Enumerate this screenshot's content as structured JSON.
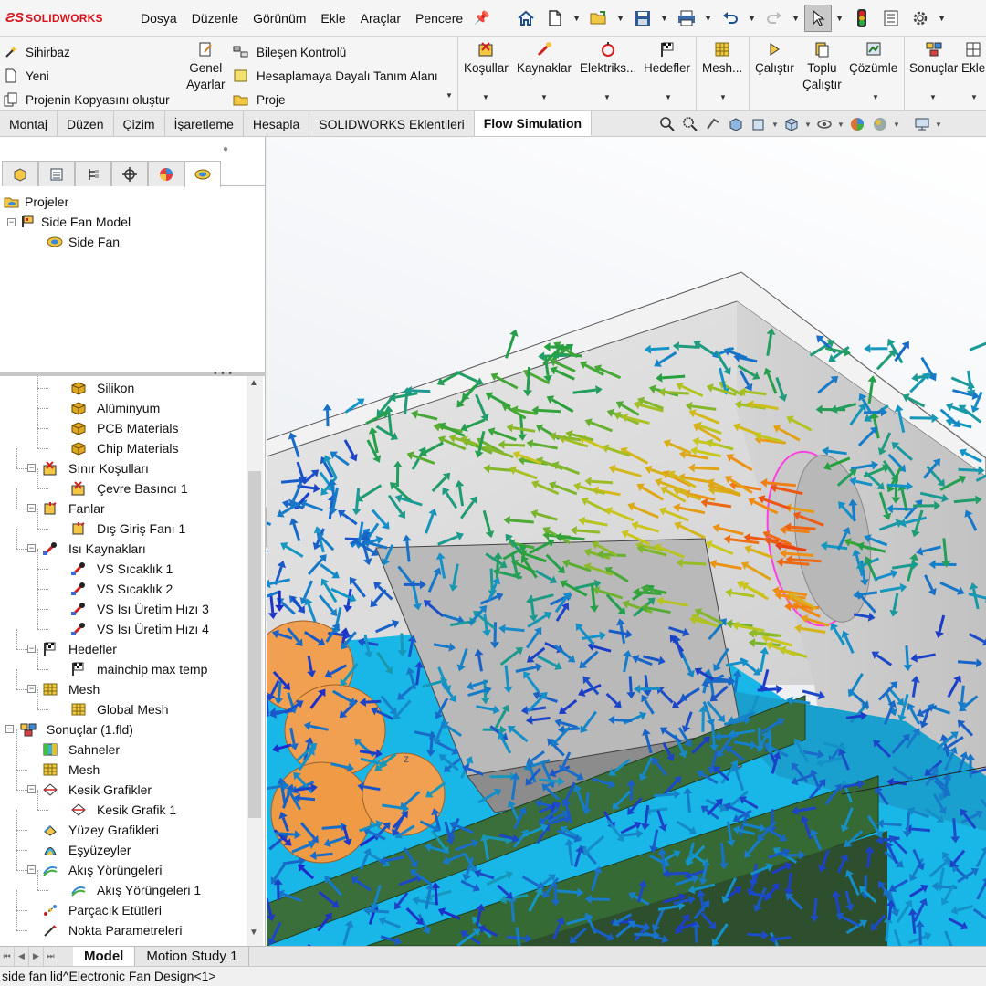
{
  "app": {
    "logo_ds": "ƧS",
    "logo_text": "SOLIDWORKS"
  },
  "menu": [
    "Dosya",
    "Düzenle",
    "Görünüm",
    "Ekle",
    "Araçlar",
    "Pencere"
  ],
  "command_manager": {
    "left_items": [
      "Sihirbaz",
      "Yeni",
      "Projenin Kopyasını oluştur"
    ],
    "general_settings": [
      "Genel",
      "Ayarlar"
    ],
    "mid_items": [
      "Bileşen Kontrolü",
      "Hesaplamaya Dayalı Tanım Alanı",
      "Proje"
    ],
    "buttons": [
      "Koşullar",
      "Kaynaklar",
      "Elektriks...",
      "Hedefler",
      "Mesh...",
      "Çalıştır",
      "Toplu",
      "Çalıştır",
      "Çözümle",
      "Sonuçlar",
      "Ekle"
    ]
  },
  "tabs": [
    "Montaj",
    "Düzen",
    "Çizim",
    "İşaretleme",
    "Hesapla",
    "SOLIDWORKS Eklentileri",
    "Flow Simulation"
  ],
  "project_tree": [
    "Projeler",
    "Side Fan Model",
    "Side Fan"
  ],
  "feature_tree": [
    "Silikon",
    "Alüminyum",
    "PCB Materials",
    "Chip Materials",
    "Sınır Koşulları",
    "Çevre Basıncı 1",
    "Fanlar",
    "Dış Giriş Fanı 1",
    "Isı Kaynakları",
    "VS Sıcaklık 1",
    "VS Sıcaklık 2",
    "VS Isı Üretim Hızı 3",
    "VS Isı Üretim Hızı 4",
    "Hedefler",
    "mainchip max temp",
    "Mesh",
    "Global Mesh",
    "Sonuçlar (1.fld)",
    "Sahneler",
    "Mesh",
    "Kesik Grafikler",
    "Kesik Grafik 1",
    "Yüzey Grafikleri",
    "Eşyüzeyler",
    "Akış Yörüngeleri",
    "Akış Yörüngeleri 1",
    "Parçacık Etütleri",
    "Nokta Parametreleri"
  ],
  "bottom_tabs": [
    "Model",
    "Motion Study 1"
  ],
  "status_text": "side fan lid^Electronic Fan Design<1>",
  "colors": {
    "brand": "#d8141b",
    "fan_ring": "#ff3fe0",
    "pcb": "#3a6e3a",
    "floor": "#19b6e8"
  }
}
